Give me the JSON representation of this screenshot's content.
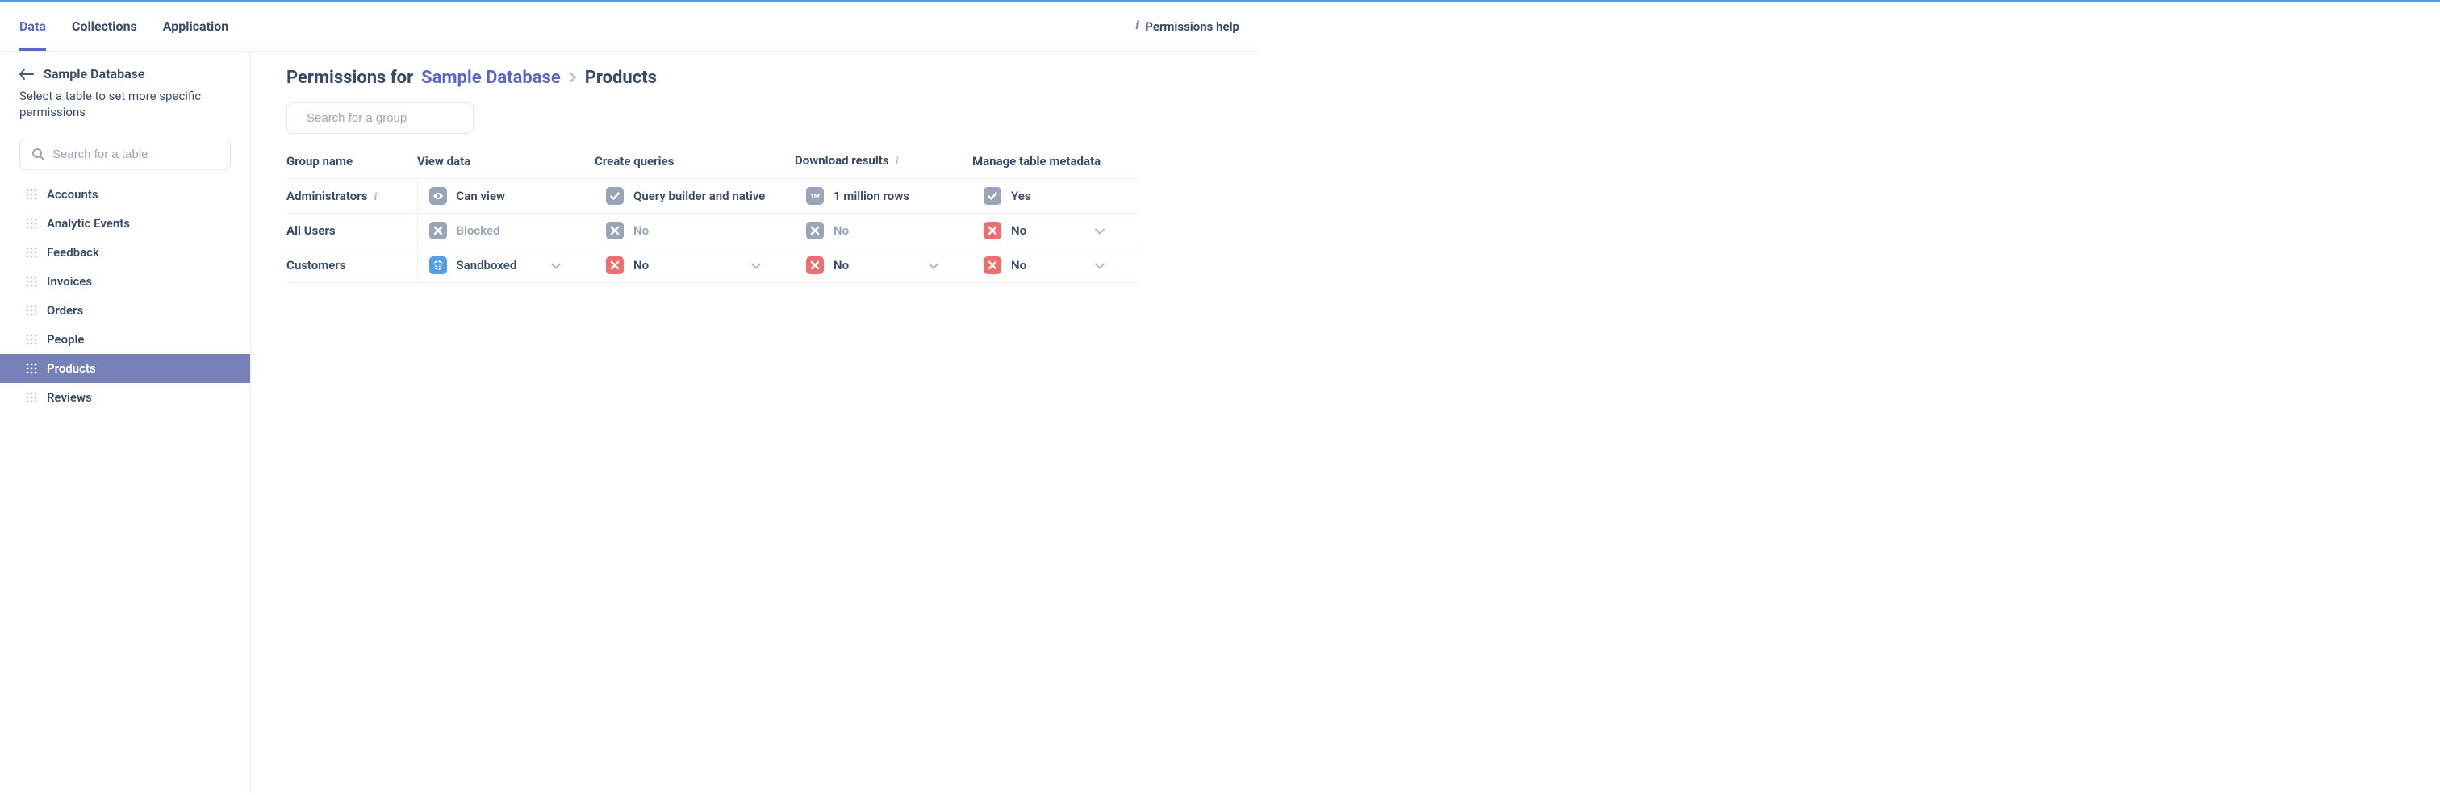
{
  "topnav": {
    "tabs": [
      "Data",
      "Collections",
      "Application"
    ],
    "active_index": 0,
    "help_label": "Permissions help"
  },
  "sidebar": {
    "back_label": "Sample Database",
    "description": "Select a table to set more specific permissions",
    "search_placeholder": "Search for a table",
    "tables": [
      "Accounts",
      "Analytic Events",
      "Feedback",
      "Invoices",
      "Orders",
      "People",
      "Products",
      "Reviews"
    ],
    "active_index": 6
  },
  "main": {
    "breadcrumb": {
      "prefix": "Permissions for",
      "database": "Sample Database",
      "current": "Products"
    },
    "group_search_placeholder": "Search for a group",
    "columns": {
      "group": "Group name",
      "view": "View data",
      "query": "Create queries",
      "download": "Download results",
      "metadata": "Manage table metadata"
    },
    "rows": [
      {
        "group": "Administrators",
        "group_info": true,
        "view": {
          "label": "Can view",
          "icon": "eye",
          "color": "gray",
          "chevron": false
        },
        "query": {
          "label": "Query builder and native",
          "icon": "check",
          "color": "gray",
          "chevron": false
        },
        "download": {
          "label": "1 million rows",
          "icon": "1m",
          "color": "gray",
          "chevron": false
        },
        "metadata": {
          "label": "Yes",
          "icon": "check",
          "color": "gray",
          "chevron": false
        }
      },
      {
        "group": "All Users",
        "group_info": false,
        "view": {
          "label": "Blocked",
          "icon": "x",
          "color": "gray",
          "muted": true,
          "chevron": false
        },
        "query": {
          "label": "No",
          "icon": "x",
          "color": "gray",
          "muted": true,
          "chevron": false
        },
        "download": {
          "label": "No",
          "icon": "x",
          "color": "gray",
          "muted": true,
          "chevron": false
        },
        "metadata": {
          "label": "No",
          "icon": "x",
          "color": "red",
          "chevron": true
        }
      },
      {
        "group": "Customers",
        "group_info": false,
        "view": {
          "label": "Sandboxed",
          "icon": "sandbox",
          "color": "blue",
          "chevron": true
        },
        "query": {
          "label": "No",
          "icon": "x",
          "color": "red",
          "chevron": true
        },
        "download": {
          "label": "No",
          "icon": "x",
          "color": "red",
          "chevron": true
        },
        "metadata": {
          "label": "No",
          "icon": "x",
          "color": "red",
          "chevron": true
        }
      }
    ]
  }
}
